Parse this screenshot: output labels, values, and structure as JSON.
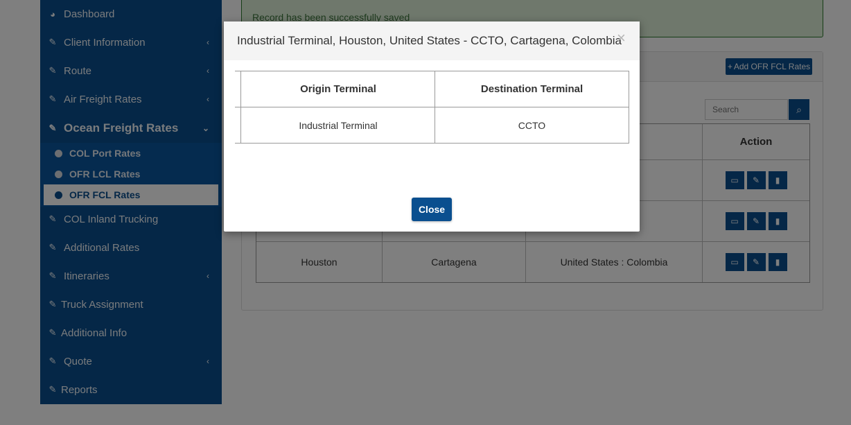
{
  "sidebar": {
    "items": [
      {
        "label": "Dashboard",
        "icon": "dashboard-icon",
        "has_chevron": false
      },
      {
        "label": "Client Information",
        "icon": "edit-icon",
        "has_chevron": true
      },
      {
        "label": "Route",
        "icon": "edit-icon",
        "has_chevron": true
      },
      {
        "label": "Air Freight Rates",
        "icon": "edit-icon",
        "has_chevron": true
      },
      {
        "label": "Ocean Freight Rates",
        "icon": "edit-icon",
        "has_chevron": true,
        "expanded": true
      },
      {
        "label": "COL Inland Trucking",
        "icon": "edit-icon",
        "has_chevron": false
      },
      {
        "label": "Additional Rates",
        "icon": "edit-icon",
        "has_chevron": false
      },
      {
        "label": "Itineraries",
        "icon": "edit-icon",
        "has_chevron": true
      },
      {
        "label": "Truck Assignment",
        "icon": "edit-icon",
        "has_chevron": false
      },
      {
        "label": "Additional Info",
        "icon": "edit-icon",
        "has_chevron": false
      },
      {
        "label": "Quote",
        "icon": "edit-icon",
        "has_chevron": true
      },
      {
        "label": "Reports",
        "icon": "edit-icon",
        "has_chevron": false
      }
    ],
    "subitems": [
      {
        "label": "COL Port Rates"
      },
      {
        "label": "OFR LCL Rates"
      },
      {
        "label": "OFR FCL Rates",
        "selected": true
      }
    ]
  },
  "alert": {
    "text": "Record has been successfully saved"
  },
  "panel": {
    "add_button": "Add OFR FCL Rates",
    "search_placeholder": "Search",
    "table": {
      "headers": [
        "",
        "",
        "",
        "Action"
      ],
      "rows": [
        [
          "",
          "",
          "olombia"
        ],
        [
          "",
          "",
          "olombia"
        ],
        [
          "Houston",
          "Cartagena",
          "United States : Colombia"
        ]
      ]
    }
  },
  "modal": {
    "title": "Industrial Terminal, Houston, United States - CCTO, Cartagena, Colombia",
    "close_x": "×",
    "table": {
      "headers": [
        "Origin Terminal",
        "Destination Terminal"
      ],
      "rows": [
        [
          "Industrial Terminal",
          "CCTO"
        ]
      ]
    },
    "close_button": "Close"
  },
  "colors": {
    "brand": "#0a4f8f",
    "submenu_bg": "#0b579f",
    "alert_bg": "#dff0d8",
    "alert_text": "#3c763d",
    "overlay": "rgba(0,0,0,0.5)"
  }
}
